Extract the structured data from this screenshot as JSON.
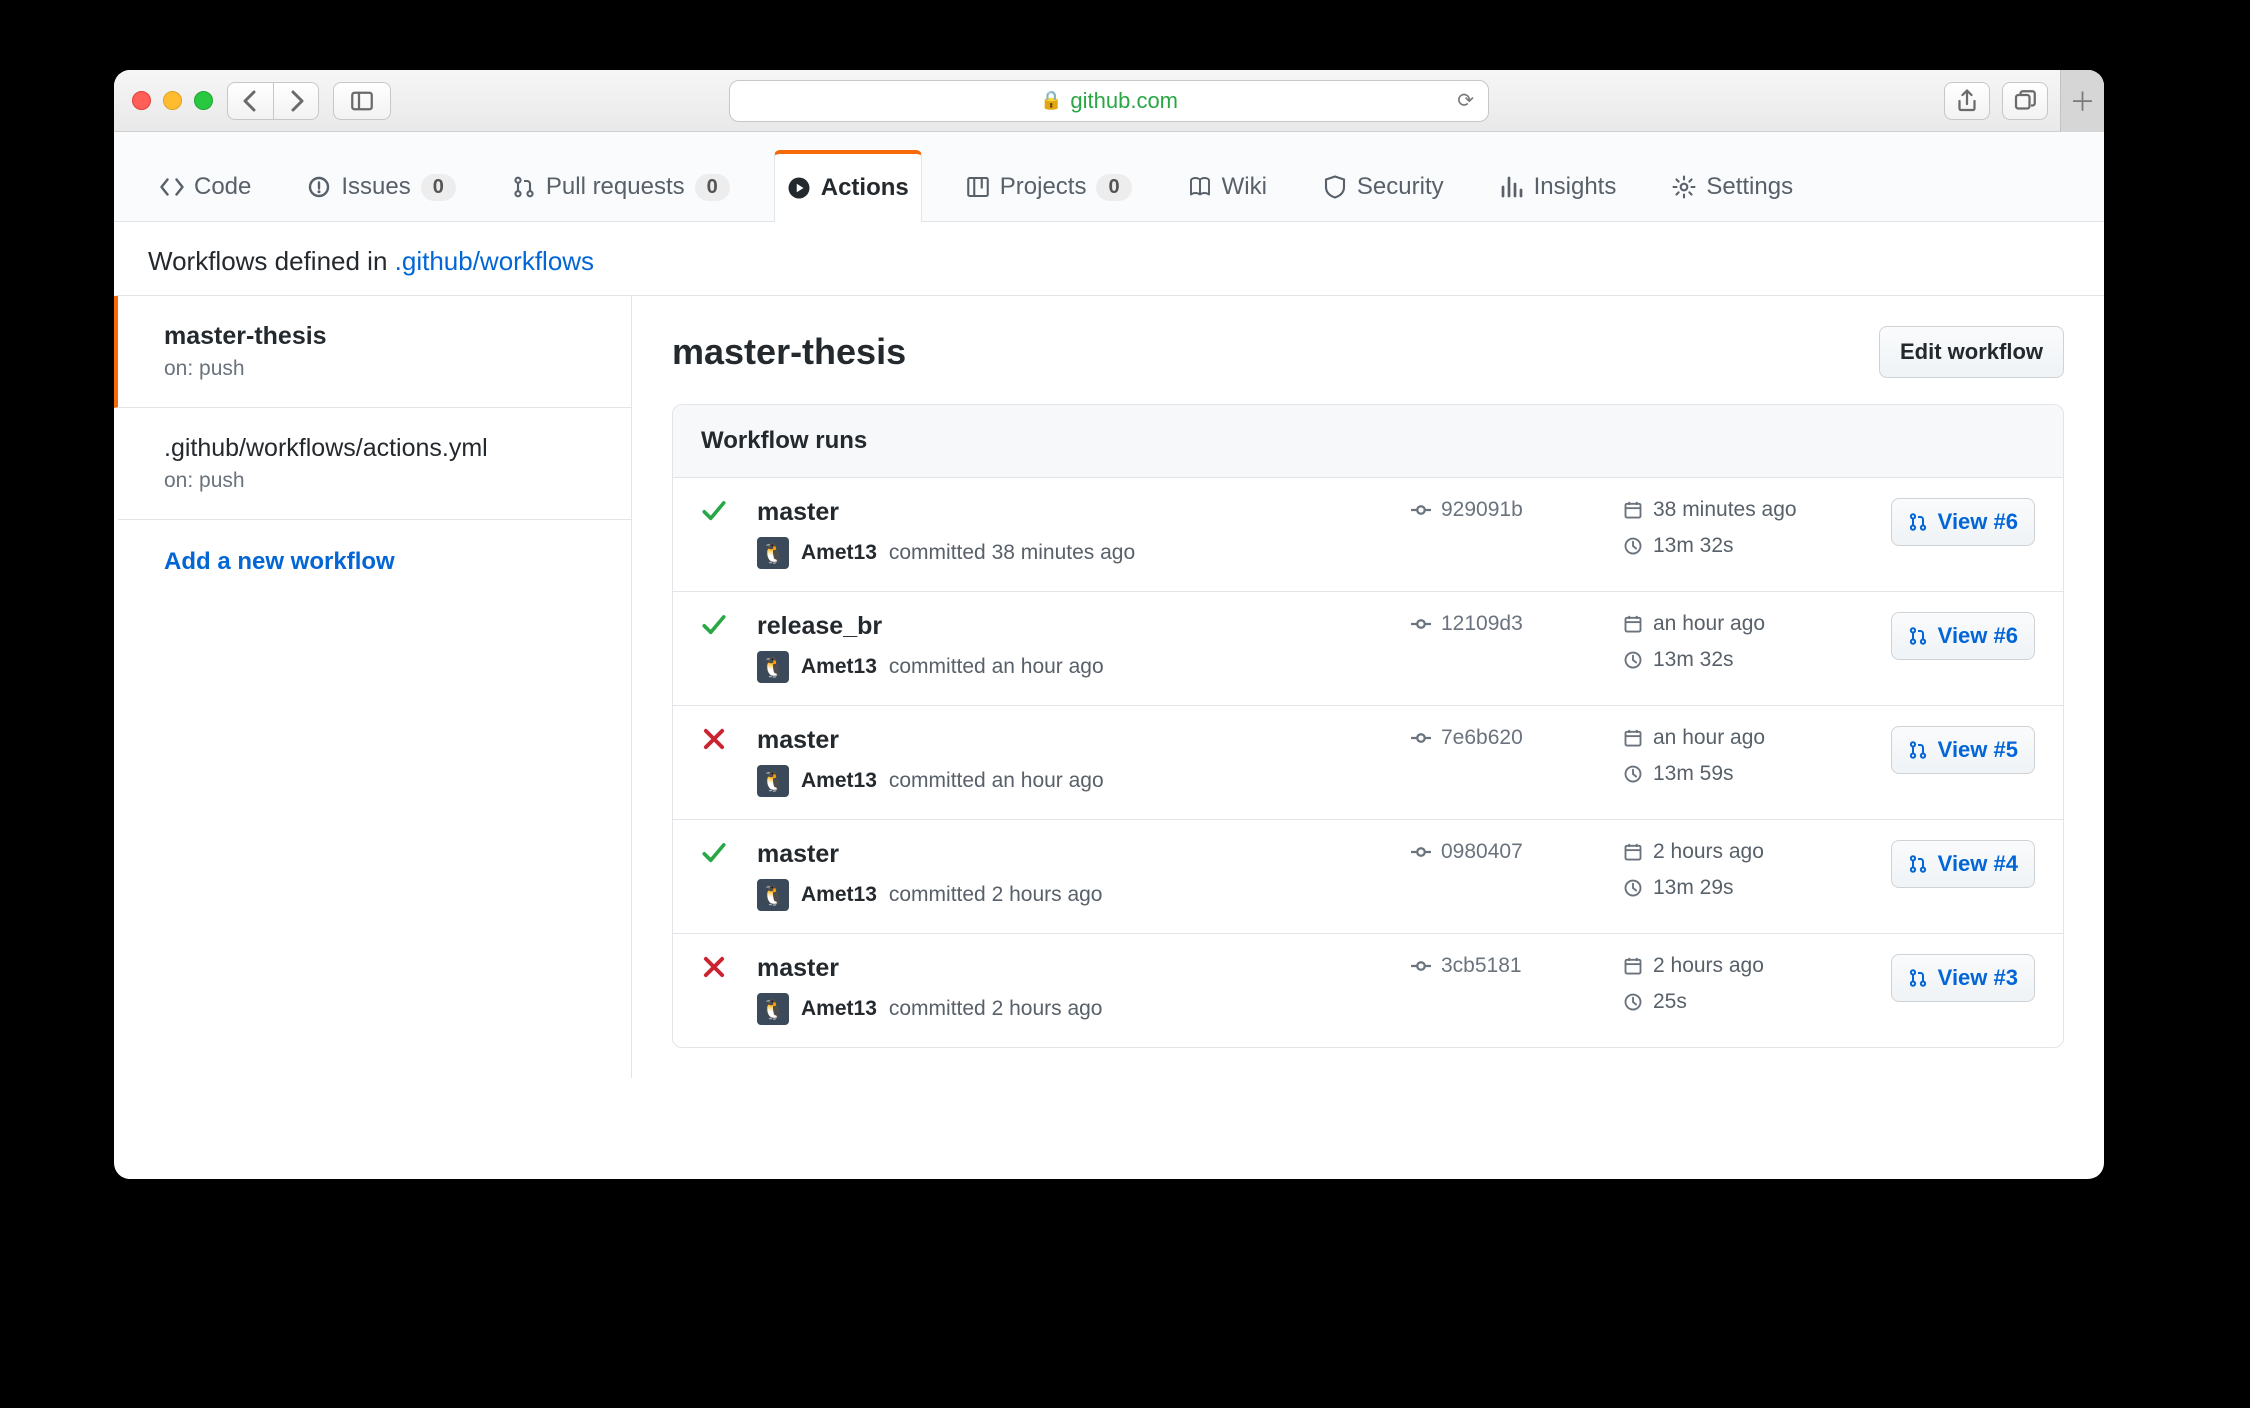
{
  "browser": {
    "domain": "github.com"
  },
  "tabs": {
    "code": "Code",
    "issues": "Issues",
    "issues_count": "0",
    "pulls": "Pull requests",
    "pulls_count": "0",
    "actions": "Actions",
    "projects": "Projects",
    "projects_count": "0",
    "wiki": "Wiki",
    "security": "Security",
    "insights": "Insights",
    "settings": "Settings"
  },
  "pathline": {
    "prefix": "Workflows defined in ",
    "link": ".github/workflows"
  },
  "sidebar": {
    "items": [
      {
        "title": "master-thesis",
        "sub": "on: push",
        "active": true
      },
      {
        "title": ".github/workflows/actions.yml",
        "sub": "on: push",
        "active": false
      }
    ],
    "add": "Add a new workflow"
  },
  "main": {
    "title": "master-thesis",
    "edit": "Edit workflow",
    "runs_header": "Workflow runs",
    "runs": [
      {
        "status": "ok",
        "branch": "master",
        "author": "Amet13",
        "committed": "committed 38 minutes ago",
        "sha": "929091b",
        "time": "38 minutes ago",
        "duration": "13m 32s",
        "view": "View #6"
      },
      {
        "status": "ok",
        "branch": "release_br",
        "author": "Amet13",
        "committed": "committed an hour ago",
        "sha": "12109d3",
        "time": "an hour ago",
        "duration": "13m 32s",
        "view": "View #6"
      },
      {
        "status": "fail",
        "branch": "master",
        "author": "Amet13",
        "committed": "committed an hour ago",
        "sha": "7e6b620",
        "time": "an hour ago",
        "duration": "13m 59s",
        "view": "View #5"
      },
      {
        "status": "ok",
        "branch": "master",
        "author": "Amet13",
        "committed": "committed 2 hours ago",
        "sha": "0980407",
        "time": "2 hours ago",
        "duration": "13m 29s",
        "view": "View #4"
      },
      {
        "status": "fail",
        "branch": "master",
        "author": "Amet13",
        "committed": "committed 2 hours ago",
        "sha": "3cb5181",
        "time": "2 hours ago",
        "duration": "25s",
        "view": "View #3"
      }
    ]
  }
}
